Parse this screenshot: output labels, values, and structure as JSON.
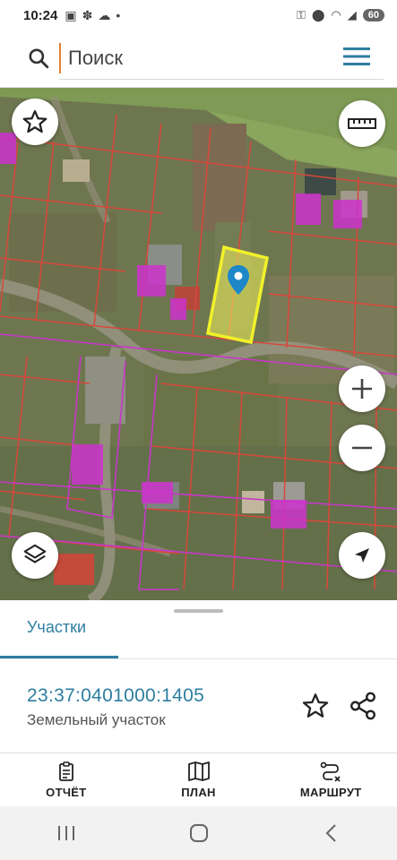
{
  "status_bar": {
    "time": "10:24",
    "battery": "60",
    "left_icons": [
      "image-icon",
      "fan-icon",
      "cloud-icon",
      "dot-icon"
    ],
    "right_icons": [
      "vpn-key-icon",
      "location-icon",
      "wifi-icon",
      "signal-icon"
    ]
  },
  "search": {
    "placeholder": "Поиск"
  },
  "map": {
    "selected_parcel_color": "#f3f35a",
    "boundary_color": "#d8473a",
    "zone_color": "#c837c8",
    "pin_color": "#1d87c8"
  },
  "sheet": {
    "tab_label": "Участки",
    "parcel_id": "23:37:0401000:1405",
    "parcel_type": "Земельный участок"
  },
  "actions": {
    "report": "ОТЧЁТ",
    "plan": "ПЛАН",
    "route": "МАРШРУТ"
  },
  "colors": {
    "accent": "#2d7ea0",
    "cursor": "#e08030"
  }
}
